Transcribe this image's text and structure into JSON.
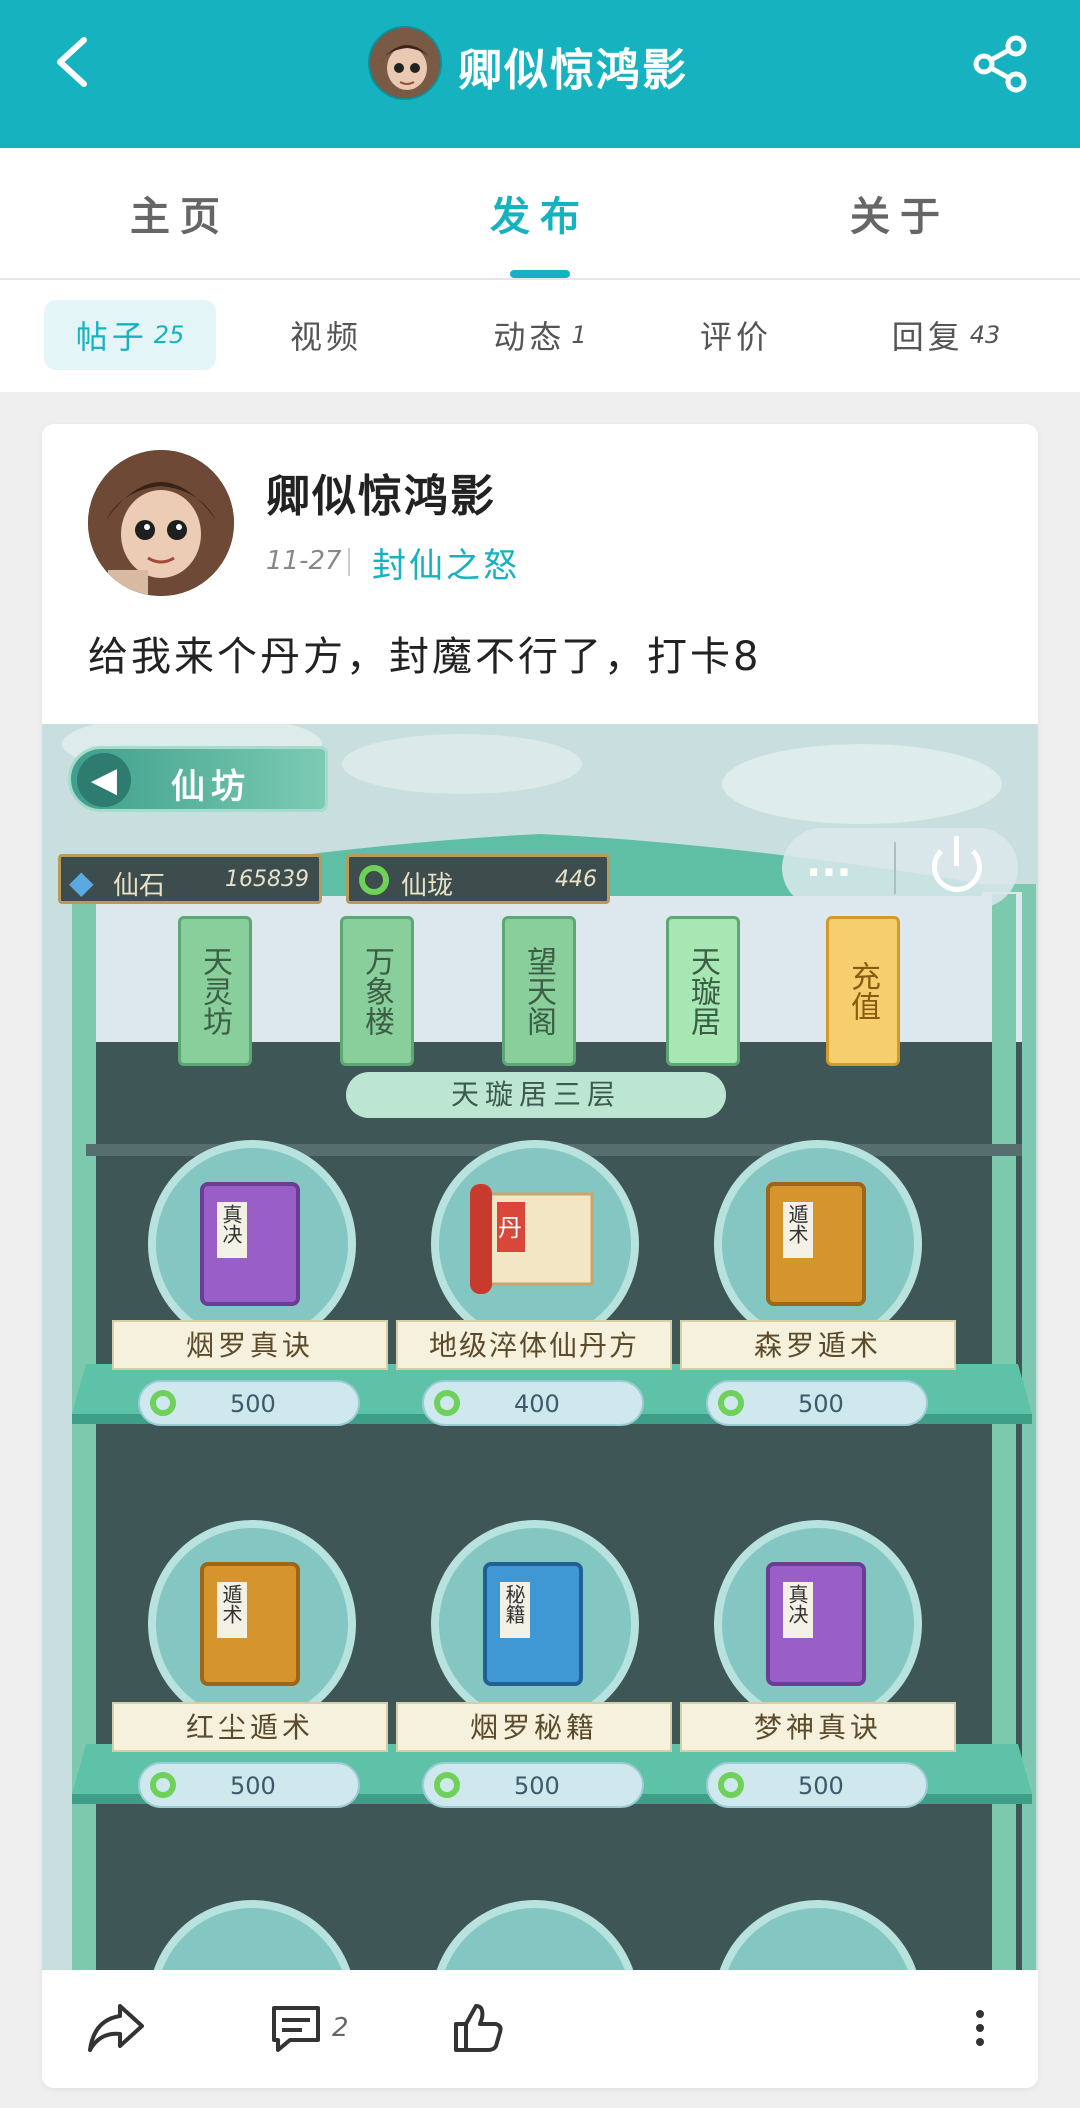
{
  "header": {
    "username": "卿似惊鸿影",
    "back_icon": "chevron-left-icon",
    "share_icon": "share-icon"
  },
  "main_tabs": [
    {
      "label": "主页"
    },
    {
      "label": "发布"
    },
    {
      "label": "关于"
    }
  ],
  "sub_tabs": [
    {
      "label": "帖子",
      "count": "25"
    },
    {
      "label": "视频",
      "count": ""
    },
    {
      "label": "动态",
      "count": "1"
    },
    {
      "label": "评价",
      "count": ""
    },
    {
      "label": "回复",
      "count": "43"
    }
  ],
  "post": {
    "author": "卿似惊鸿影",
    "date": "11-27",
    "game": "封仙之怒",
    "text": "给我来个丹方，封魔不行了，打卡8",
    "comment_count": "2"
  },
  "game_screenshot": {
    "panel_title": "仙坊",
    "currency_1_label": "仙石",
    "currency_1_value": "165839",
    "currency_2_label": "仙珑",
    "currency_2_value": "446",
    "more_button": "...",
    "shop_tags": [
      "天灵坊",
      "万象楼",
      "望天阁",
      "天璇居",
      "充值"
    ],
    "floor_banner": "天璇居三层",
    "items": [
      {
        "name": "烟罗真诀",
        "price": "500",
        "cover": "真决"
      },
      {
        "name": "地级淬体仙丹方",
        "price": "400",
        "cover": "丹"
      },
      {
        "name": "森罗遁术",
        "price": "500",
        "cover": "遁术"
      },
      {
        "name": "红尘遁术",
        "price": "500",
        "cover": "遁术"
      },
      {
        "name": "烟罗秘籍",
        "price": "500",
        "cover": "秘籍"
      },
      {
        "name": "梦神真诀",
        "price": "500",
        "cover": "真决"
      }
    ]
  },
  "colors": {
    "accent": "#16b2bf",
    "jade": "#5fbfa5",
    "dark_panel": "#3f5656"
  }
}
